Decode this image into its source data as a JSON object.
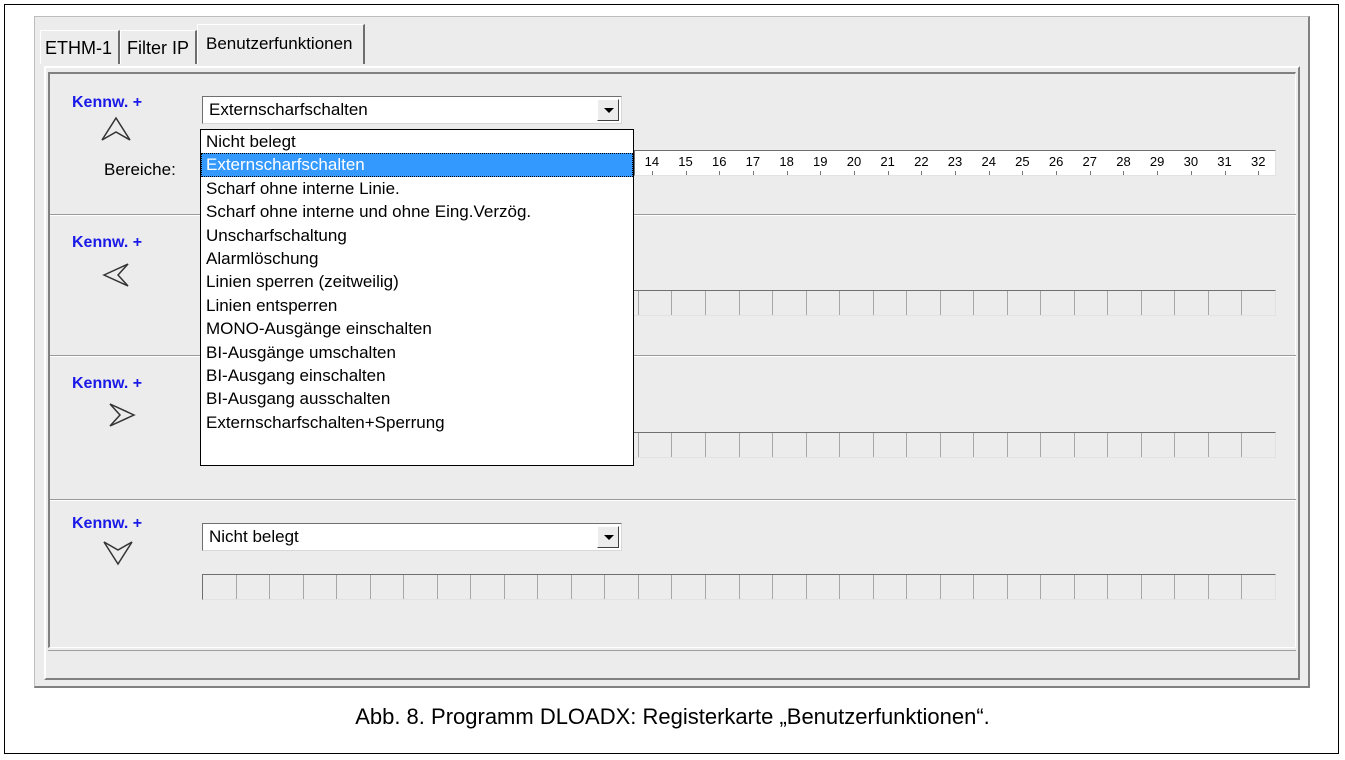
{
  "tabs": [
    {
      "label": "ETHM-1"
    },
    {
      "label": "Filter IP"
    },
    {
      "label": "Benutzerfunktionen"
    }
  ],
  "rows": [
    {
      "prefix": "Kennw. +",
      "arrow": "arrow-up-icon",
      "selected": "Externscharfschalten"
    },
    {
      "prefix": "Kennw. +",
      "arrow": "arrow-left-icon",
      "selected": ""
    },
    {
      "prefix": "Kennw. +",
      "arrow": "arrow-right-icon",
      "selected": ""
    },
    {
      "prefix": "Kennw. +",
      "arrow": "arrow-down-icon",
      "selected": "Nicht belegt"
    }
  ],
  "bereiche_label": "Bereiche:",
  "partition_numbers": [
    "14",
    "15",
    "16",
    "17",
    "18",
    "19",
    "20",
    "21",
    "22",
    "23",
    "24",
    "25",
    "26",
    "27",
    "28",
    "29",
    "30",
    "31",
    "32"
  ],
  "dropdown_options": [
    "Nicht belegt",
    "Externscharfschalten",
    "Scharf ohne interne Linie.",
    "Scharf ohne interne und ohne Eing.Verzög.",
    "Unscharfschaltung",
    "Alarmlöschung",
    "Linien sperren (zeitweilig)",
    "Linien entsperren",
    "MONO-Ausgänge einschalten",
    "BI-Ausgänge umschalten",
    "BI-Ausgang einschalten",
    "BI-Ausgang ausschalten",
    "Externscharfschalten+Sperrung"
  ],
  "dropdown_selected_index": 1,
  "caption": "Abb. 8. Programm DLOADX: Registerkarte „Benutzerfunktionen“.",
  "colors": {
    "kennw": "#1a1ae8",
    "selection": "#3399ff"
  }
}
